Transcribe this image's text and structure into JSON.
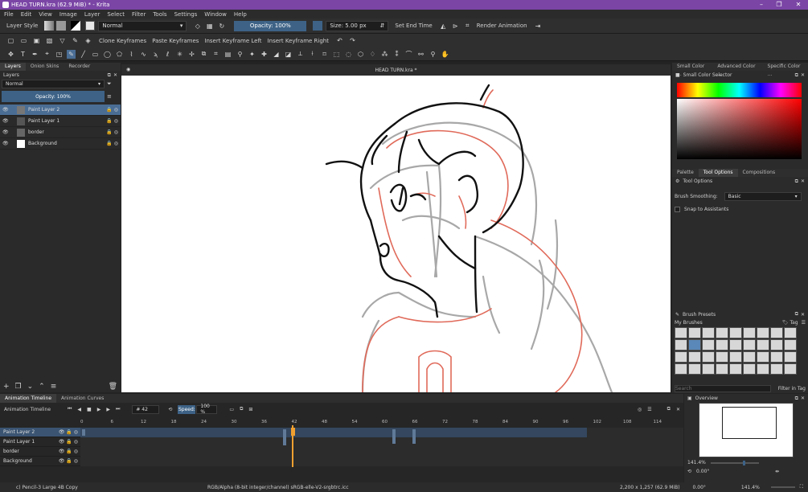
{
  "window": {
    "title": "HEAD TURN.kra (62.9 MiB)  * - Krita"
  },
  "menu": [
    "File",
    "Edit",
    "View",
    "Image",
    "Layer",
    "Select",
    "Filter",
    "Tools",
    "Settings",
    "Window",
    "Help"
  ],
  "toolbar": {
    "layer_style_label": "Layer Style",
    "blend_mode": "Normal",
    "opacity": "Opacity: 100%",
    "size": "Size: 5.00 px",
    "set_end_time": "Set End Time",
    "render_animation": "Render Animation"
  },
  "toolbar2": {
    "clone_keyframes": "Clone Keyframes",
    "paste_keyframes": "Paste Keyframes",
    "insert_left": "Insert Keyframe Left",
    "insert_right": "Insert Keyframe Right"
  },
  "left_panel": {
    "tabs": [
      "Layers",
      "Onion Skins",
      "Recorder"
    ],
    "title": "Layers",
    "blend_mode": "Normal",
    "opacity": "Opacity:  100%",
    "layers": [
      {
        "name": "Paint Layer 2",
        "selected": true
      },
      {
        "name": "Paint Layer 1",
        "selected": false
      },
      {
        "name": "border",
        "selected": false
      },
      {
        "name": "Background",
        "selected": false
      }
    ]
  },
  "canvas": {
    "doc_title": "HEAD TURN.kra *"
  },
  "right_panel": {
    "color_tabs": [
      "Small Color ...",
      "Advanced Color ...",
      "Specific Color ..."
    ],
    "color_selector_title": "Small Color Selector",
    "options_tabs": [
      "Palette",
      "Tool Options",
      "Compositions"
    ],
    "tool_options_title": "Tool Options",
    "brush_smoothing_label": "Brush Smoothing:",
    "brush_smoothing_value": "Basic",
    "snap_label": "Snap to Assistants",
    "brush_presets_title": "Brush Presets",
    "my_brushes": "My Brushes",
    "tag_label": "Tag",
    "search_placeholder": "Search",
    "filter_tag": "Filter in Tag"
  },
  "timeline": {
    "tabs": [
      "Animation Timeline",
      "Animation Curves"
    ],
    "title": "Animation Timeline",
    "frame": "42",
    "speed_label": "Speed:",
    "speed_value": "100 %",
    "ruler": [
      "0",
      "6",
      "12",
      "18",
      "24",
      "30",
      "36",
      "42",
      "48",
      "54",
      "60",
      "66",
      "72",
      "78",
      "84",
      "90",
      "96",
      "102",
      "108",
      "114"
    ],
    "layers": [
      "Paint Layer 2",
      "Paint Layer 1",
      "border",
      "Background"
    ]
  },
  "overview": {
    "title": "Overview",
    "zoom": "141.4%",
    "rotation": "0.00°"
  },
  "status": {
    "brush": "c) Pencil-3 Large 4B Copy",
    "colorspace": "RGB/Alpha (8-bit integer/channel)  sRGB-elle-V2-srgbtrc.icc",
    "dimensions": "2,200 x 1,257 (62.9 MiB)",
    "rotation": "0.00°",
    "zoom": "141.4%"
  },
  "colors": {
    "accent": "#7a45a5",
    "selection": "#4a6d94",
    "playhead": "#f0a030"
  }
}
